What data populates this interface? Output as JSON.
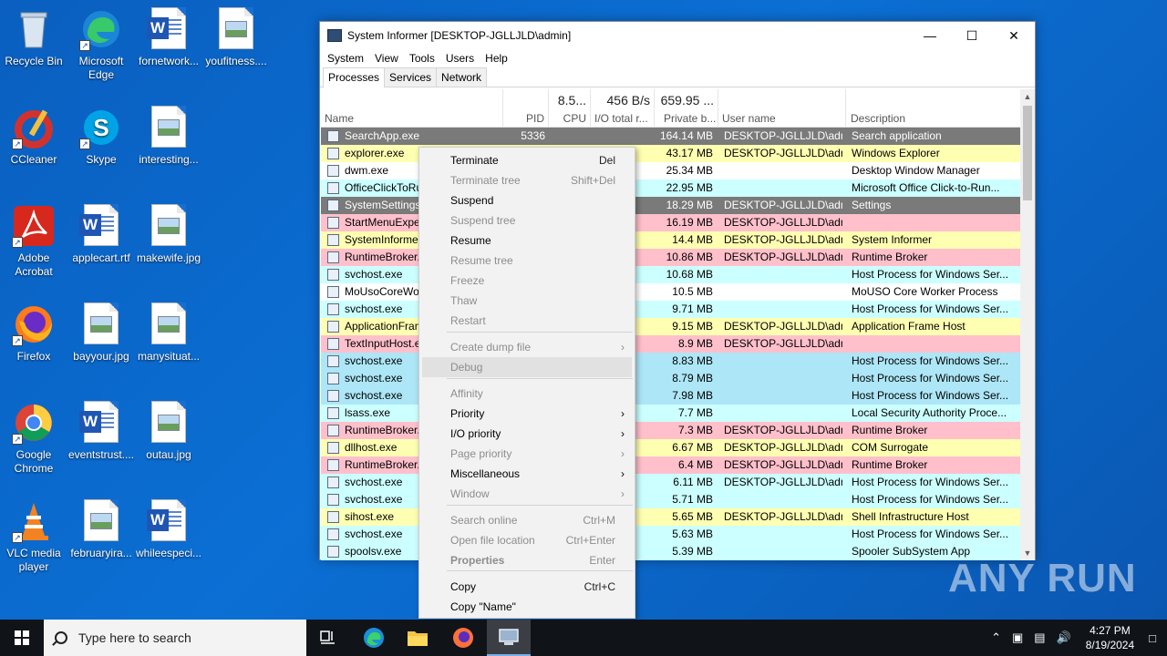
{
  "desktop": {
    "icons": [
      {
        "label": "Recycle Bin",
        "icon": "recycle-bin-icon"
      },
      {
        "label": "Microsoft Edge",
        "icon": "edge-icon"
      },
      {
        "label": "fornetwork...",
        "icon": "word-doc-icon"
      },
      {
        "label": "youfitness....",
        "icon": "image-file-icon"
      },
      {
        "label": "CCleaner",
        "icon": "ccleaner-icon"
      },
      {
        "label": "Skype",
        "icon": "skype-icon"
      },
      {
        "label": "interesting...",
        "icon": "image-file-icon"
      },
      {
        "label": "Adobe Acrobat",
        "icon": "acrobat-icon"
      },
      {
        "label": "applecart.rtf",
        "icon": "word-doc-icon"
      },
      {
        "label": "makewife.jpg",
        "icon": "image-file-icon"
      },
      {
        "label": "Firefox",
        "icon": "firefox-icon"
      },
      {
        "label": "bayyour.jpg",
        "icon": "image-file-icon"
      },
      {
        "label": "manysituat...",
        "icon": "image-file-icon"
      },
      {
        "label": "Google Chrome",
        "icon": "chrome-icon"
      },
      {
        "label": "eventstrust....",
        "icon": "word-doc-icon"
      },
      {
        "label": "outau.jpg",
        "icon": "image-file-icon"
      },
      {
        "label": "VLC media player",
        "icon": "vlc-icon"
      },
      {
        "label": "februaryira...",
        "icon": "image-file-icon"
      },
      {
        "label": "whileespeci...",
        "icon": "word-doc-icon"
      }
    ]
  },
  "window": {
    "title": "System Informer [DESKTOP-JGLLJLD\\admin]",
    "menu": [
      "System",
      "View",
      "Tools",
      "Users",
      "Help"
    ],
    "tabs": [
      "Processes",
      "Services",
      "Network"
    ],
    "columns": {
      "name": "Name",
      "pid": "PID",
      "cpu_total": "8.5...",
      "cpu": "CPU",
      "io_total": "456 B/s",
      "io": "I/O total r...",
      "private_total": "659.95 ...",
      "private": "Private b...",
      "user": "User name",
      "desc": "Description"
    },
    "rows": [
      {
        "name": "SearchApp.exe",
        "pid": "5336",
        "mem": "164.14 MB",
        "user": "DESKTOP-JGLLJLD\\admi",
        "desc": "Search application",
        "color": "#7a7a7a"
      },
      {
        "name": "explorer.exe",
        "pid": "",
        "mem": "43.17 MB",
        "user": "DESKTOP-JGLLJLD\\admi",
        "desc": "Windows Explorer",
        "color": "#ffffb2"
      },
      {
        "name": "dwm.exe",
        "pid": "",
        "mem": "25.34 MB",
        "user": "",
        "desc": "Desktop Window Manager",
        "color": "#ffffff"
      },
      {
        "name": "OfficeClickToRun.exe",
        "pid": "",
        "mem": "22.95 MB",
        "user": "",
        "desc": "Microsoft Office Click-to-Run...",
        "color": "#ccffff"
      },
      {
        "name": "SystemSettings.exe",
        "pid": "",
        "mem": "18.29 MB",
        "user": "DESKTOP-JGLLJLD\\admi",
        "desc": "Settings",
        "color": "#7a7a7a"
      },
      {
        "name": "StartMenuExperienceHost.exe",
        "pid": "",
        "mem": "16.19 MB",
        "user": "DESKTOP-JGLLJLD\\admi",
        "desc": "",
        "color": "#ffc0cb"
      },
      {
        "name": "SystemInformer.exe",
        "pid": "",
        "mem": "14.4 MB",
        "user": "DESKTOP-JGLLJLD\\admi",
        "desc": "System Informer",
        "color": "#ffffb2"
      },
      {
        "name": "RuntimeBroker.exe",
        "pid": "",
        "mem": "10.86 MB",
        "user": "DESKTOP-JGLLJLD\\admi",
        "desc": "Runtime Broker",
        "color": "#ffc0cb"
      },
      {
        "name": "svchost.exe",
        "pid": "",
        "mem": "10.68 MB",
        "user": "",
        "desc": "Host Process for Windows Ser...",
        "color": "#ccffff"
      },
      {
        "name": "MoUsoCoreWorker.exe",
        "pid": "",
        "mem": "10.5 MB",
        "user": "",
        "desc": "MoUSO Core Worker Process",
        "color": "#ffffff"
      },
      {
        "name": "svchost.exe",
        "pid": "",
        "mem": "9.71 MB",
        "user": "",
        "desc": "Host Process for Windows Ser...",
        "color": "#ccffff"
      },
      {
        "name": "ApplicationFrameHost.exe",
        "pid": "",
        "mem": "9.15 MB",
        "user": "DESKTOP-JGLLJLD\\admi",
        "desc": "Application Frame Host",
        "color": "#ffffb2"
      },
      {
        "name": "TextInputHost.exe",
        "pid": "",
        "mem": "8.9 MB",
        "user": "DESKTOP-JGLLJLD\\admi",
        "desc": "",
        "color": "#ffc0cb"
      },
      {
        "name": "svchost.exe",
        "pid": "",
        "mem": "8.83 MB",
        "user": "",
        "desc": "Host Process for Windows Ser...",
        "color": "#ade6f7"
      },
      {
        "name": "svchost.exe",
        "pid": "",
        "mem": "8.79 MB",
        "user": "",
        "desc": "Host Process for Windows Ser...",
        "color": "#ade6f7"
      },
      {
        "name": "svchost.exe",
        "pid": "",
        "mem": "7.98 MB",
        "user": "",
        "desc": "Host Process for Windows Ser...",
        "color": "#ade6f7"
      },
      {
        "name": "lsass.exe",
        "pid": "",
        "mem": "7.7 MB",
        "user": "",
        "desc": "Local Security Authority Proce...",
        "color": "#ccffff"
      },
      {
        "name": "RuntimeBroker.exe",
        "pid": "",
        "mem": "7.3 MB",
        "user": "DESKTOP-JGLLJLD\\admi",
        "desc": "Runtime Broker",
        "color": "#ffc0cb"
      },
      {
        "name": "dllhost.exe",
        "pid": "",
        "mem": "6.67 MB",
        "user": "DESKTOP-JGLLJLD\\admi",
        "desc": "COM Surrogate",
        "color": "#ffffb2"
      },
      {
        "name": "RuntimeBroker.exe",
        "pid": "",
        "mem": "6.4 MB",
        "user": "DESKTOP-JGLLJLD\\admi",
        "desc": "Runtime Broker",
        "color": "#ffc0cb"
      },
      {
        "name": "svchost.exe",
        "pid": "",
        "mem": "6.11 MB",
        "user": "DESKTOP-JGLLJLD\\admi",
        "desc": "Host Process for Windows Ser...",
        "color": "#ccffff"
      },
      {
        "name": "svchost.exe",
        "pid": "",
        "mem": "5.71 MB",
        "user": "",
        "desc": "Host Process for Windows Ser...",
        "color": "#ccffff"
      },
      {
        "name": "sihost.exe",
        "pid": "",
        "mem": "5.65 MB",
        "user": "DESKTOP-JGLLJLD\\admi",
        "desc": "Shell Infrastructure Host",
        "color": "#ffffb2"
      },
      {
        "name": "svchost.exe",
        "pid": "",
        "mem": "5.63 MB",
        "user": "",
        "desc": "Host Process for Windows Ser...",
        "color": "#ccffff"
      },
      {
        "name": "spoolsv.exe",
        "pid": "",
        "mem": "5.39 MB",
        "user": "",
        "desc": "Spooler SubSystem App",
        "color": "#ccffff"
      }
    ]
  },
  "context_menu": {
    "items": [
      {
        "label": "Terminate",
        "shortcut": "Del",
        "disabled": false
      },
      {
        "label": "Terminate tree",
        "shortcut": "Shift+Del",
        "disabled": true
      },
      {
        "label": "Suspend",
        "shortcut": "",
        "disabled": false
      },
      {
        "label": "Suspend tree",
        "shortcut": "",
        "disabled": true
      },
      {
        "label": "Resume",
        "shortcut": "",
        "disabled": false
      },
      {
        "label": "Resume tree",
        "shortcut": "",
        "disabled": true
      },
      {
        "label": "Freeze",
        "shortcut": "",
        "disabled": true
      },
      {
        "label": "Thaw",
        "shortcut": "",
        "disabled": true
      },
      {
        "label": "Restart",
        "shortcut": "",
        "disabled": true
      },
      {
        "label": "Create dump file",
        "shortcut": "",
        "disabled": true,
        "submenu": true
      },
      {
        "label": "Debug",
        "shortcut": "",
        "disabled": true,
        "highlight": true
      },
      {
        "label": "Affinity",
        "shortcut": "",
        "disabled": true
      },
      {
        "label": "Priority",
        "shortcut": "",
        "disabled": false,
        "submenu": true
      },
      {
        "label": "I/O priority",
        "shortcut": "",
        "disabled": false,
        "submenu": true
      },
      {
        "label": "Page priority",
        "shortcut": "",
        "disabled": true,
        "submenu": true
      },
      {
        "label": "Miscellaneous",
        "shortcut": "",
        "disabled": false,
        "submenu": true
      },
      {
        "label": "Window",
        "shortcut": "",
        "disabled": true,
        "submenu": true
      },
      {
        "label": "Search online",
        "shortcut": "Ctrl+M",
        "disabled": true
      },
      {
        "label": "Open file location",
        "shortcut": "Ctrl+Enter",
        "disabled": true
      },
      {
        "label": "Properties",
        "shortcut": "Enter",
        "disabled": true,
        "bold": true
      },
      {
        "label": "Copy",
        "shortcut": "Ctrl+C",
        "disabled": false
      },
      {
        "label": "Copy \"Name\"",
        "shortcut": "",
        "disabled": false
      }
    ]
  },
  "taskbar": {
    "search_placeholder": "Type here to search",
    "time": "4:27 PM",
    "date": "8/19/2024"
  },
  "watermark": "ANY RUN"
}
